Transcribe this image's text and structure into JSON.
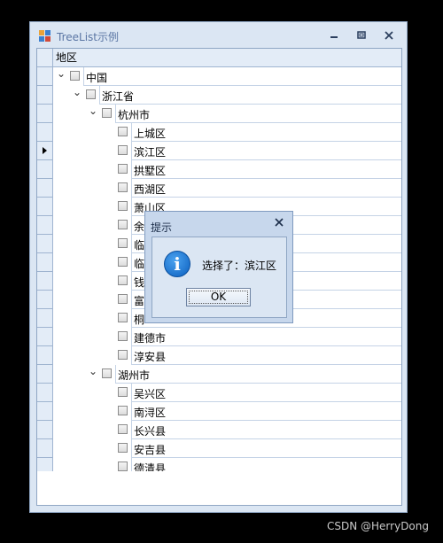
{
  "window": {
    "title": "TreeList示例",
    "icons": {
      "app": "app-windows-icon",
      "minimize": "minimize-icon",
      "restore": "restore-icon",
      "close": "close-icon"
    }
  },
  "grid": {
    "column_header": "地区",
    "rows": [
      {
        "label": "中国",
        "level": 0,
        "expander": "expanded"
      },
      {
        "label": "浙江省",
        "level": 1,
        "expander": "expanded"
      },
      {
        "label": "杭州市",
        "level": 2,
        "expander": "expanded"
      },
      {
        "label": "上城区",
        "level": 3,
        "expander": "none"
      },
      {
        "label": "滨江区",
        "level": 3,
        "expander": "none",
        "focused": true
      },
      {
        "label": "拱墅区",
        "level": 3,
        "expander": "none"
      },
      {
        "label": "西湖区",
        "level": 3,
        "expander": "none"
      },
      {
        "label": "萧山区",
        "level": 3,
        "expander": "none"
      },
      {
        "label": "余",
        "level": 3,
        "expander": "none"
      },
      {
        "label": "临",
        "level": 3,
        "expander": "none"
      },
      {
        "label": "临",
        "level": 3,
        "expander": "none"
      },
      {
        "label": "钱",
        "level": 3,
        "expander": "none"
      },
      {
        "label": "富",
        "level": 3,
        "expander": "none"
      },
      {
        "label": "桐",
        "level": 3,
        "expander": "none"
      },
      {
        "label": "建德市",
        "level": 3,
        "expander": "none"
      },
      {
        "label": "淳安县",
        "level": 3,
        "expander": "none"
      },
      {
        "label": "湖州市",
        "level": 2,
        "expander": "expanded"
      },
      {
        "label": "吴兴区",
        "level": 3,
        "expander": "none"
      },
      {
        "label": "南浔区",
        "level": 3,
        "expander": "none"
      },
      {
        "label": "长兴县",
        "level": 3,
        "expander": "none"
      },
      {
        "label": "安吉县",
        "level": 3,
        "expander": "none"
      },
      {
        "label": "德清县",
        "level": 3,
        "expander": "none"
      }
    ]
  },
  "dialog": {
    "title": "提示",
    "message": "选择了：滨江区",
    "ok_label": "OK",
    "icon": "info-icon"
  },
  "watermark": "CSDN @HerryDong"
}
